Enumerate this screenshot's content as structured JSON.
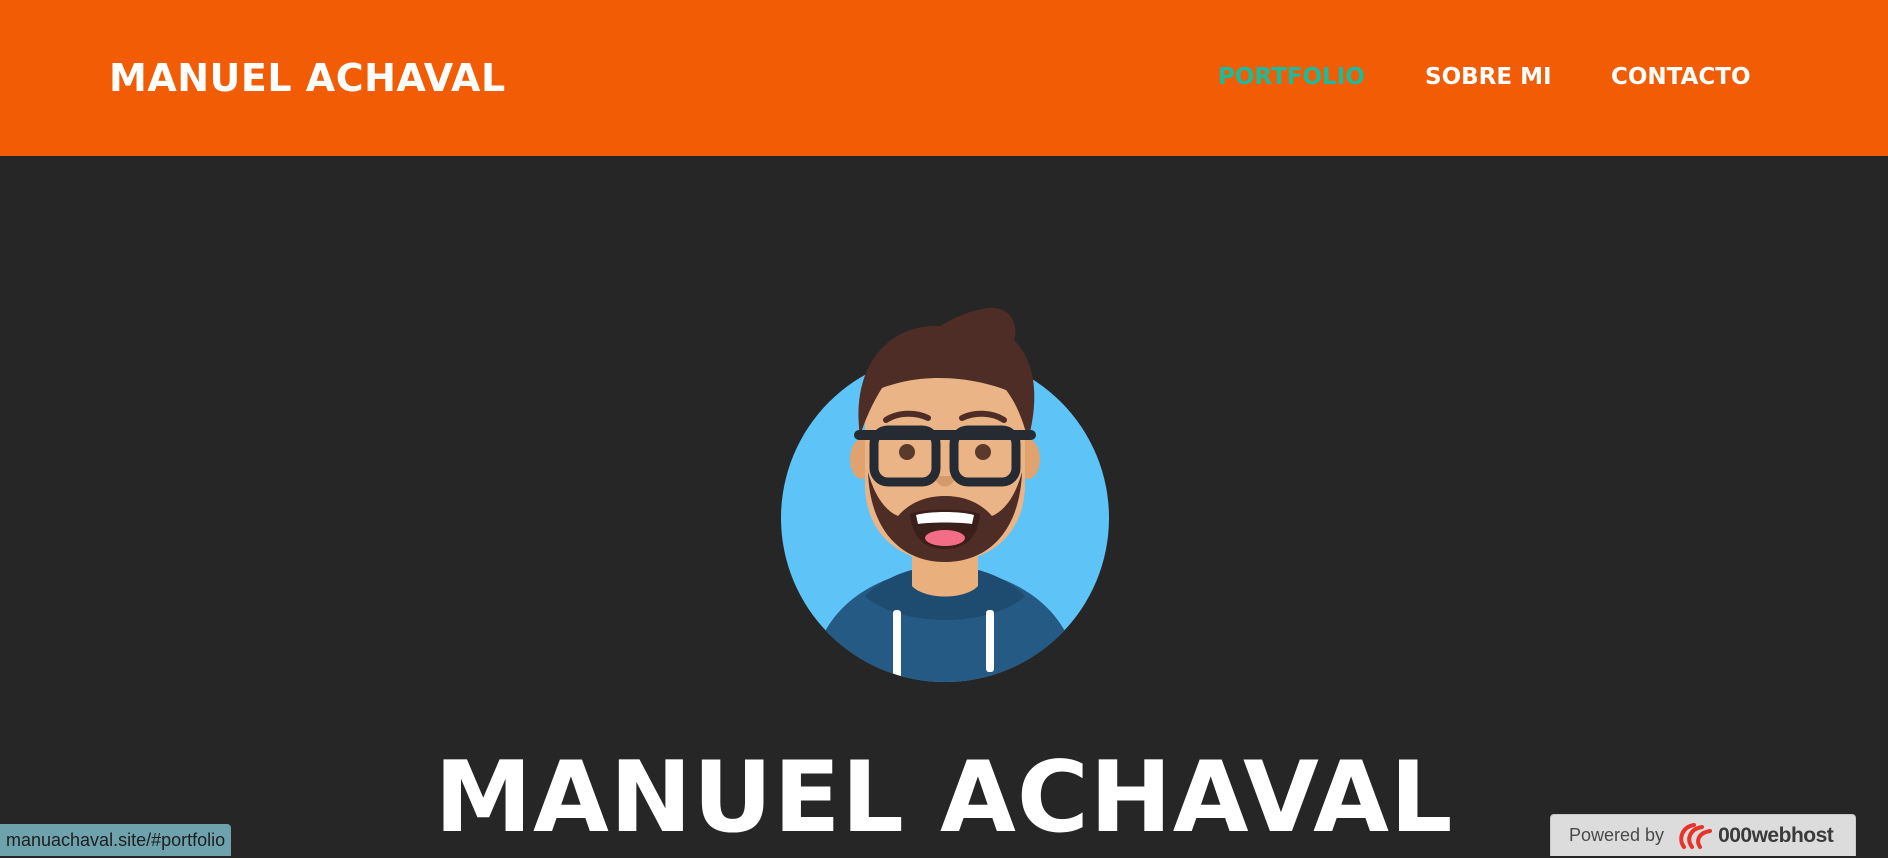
{
  "header": {
    "brand": "MANUEL ACHAVAL",
    "nav": [
      {
        "label": "PORTFOLIO",
        "active": true
      },
      {
        "label": "SOBRE MI",
        "active": false
      },
      {
        "label": "CONTACTO",
        "active": false
      }
    ]
  },
  "masthead": {
    "avatar_icon": "developer-avatar-icon",
    "title": "MANUEL ACHAVAL"
  },
  "status_bar": {
    "url": "manuachaval.site/#portfolio"
  },
  "powered_badge": {
    "label": "Powered by",
    "brand": "000webhost",
    "icon": "000webhost-logo-icon"
  },
  "colors": {
    "header_bg": "#f25c05",
    "body_bg": "#262626",
    "active_link": "#1abc9c",
    "avatar_bg": "#5ec4f7"
  }
}
